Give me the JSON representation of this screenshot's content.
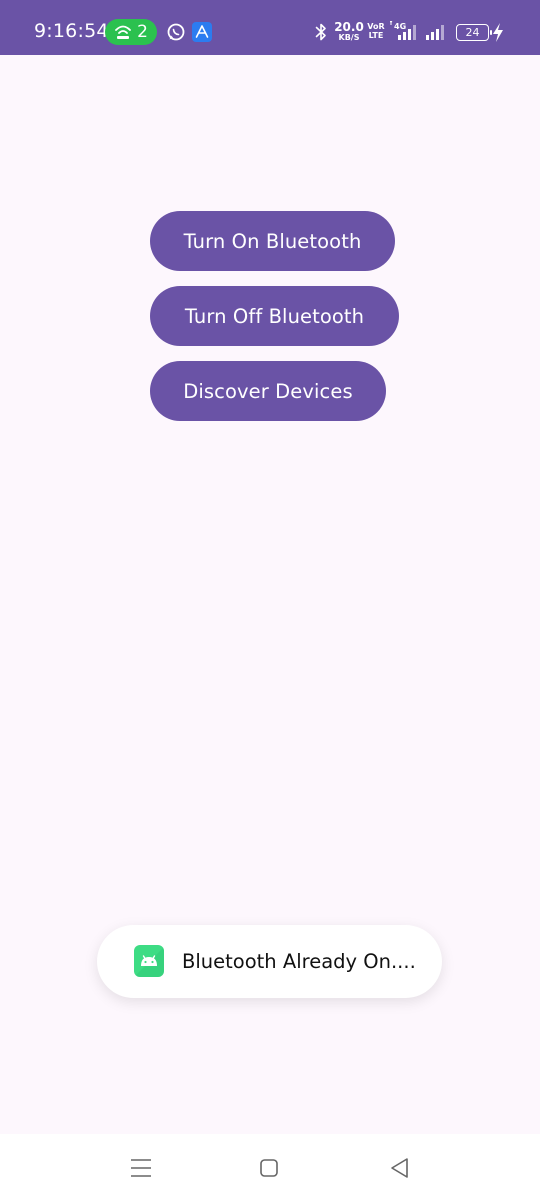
{
  "status_bar": {
    "time": "9:16:54",
    "hotspot_count": "2",
    "net_speed_value": "20.0",
    "net_speed_unit": "KB/S",
    "volte_line1": "Vo",
    "volte_line2": "LTE",
    "volte_extra": "R",
    "network_type": "4G",
    "battery_level": "24",
    "icons": [
      "hotspot-icon",
      "whatsapp-icon",
      "app-notification-icon",
      "bluetooth-icon",
      "signal-icon",
      "signal-icon",
      "battery-icon",
      "charging-icon"
    ]
  },
  "buttons": {
    "turn_on": "Turn On Bluetooth",
    "turn_off": "Turn Off Bluetooth",
    "discover": "Discover Devices"
  },
  "toast": {
    "message": "Bluetooth Already On....",
    "icon": "android-icon"
  },
  "nav_bar": {
    "icons": [
      "recent-apps-icon",
      "home-icon",
      "back-icon"
    ]
  },
  "colors": {
    "primary": "#6a53a6",
    "background": "#fdf7fd",
    "hotspot_green": "#2bc14f",
    "android_green": "#3ddc84"
  }
}
